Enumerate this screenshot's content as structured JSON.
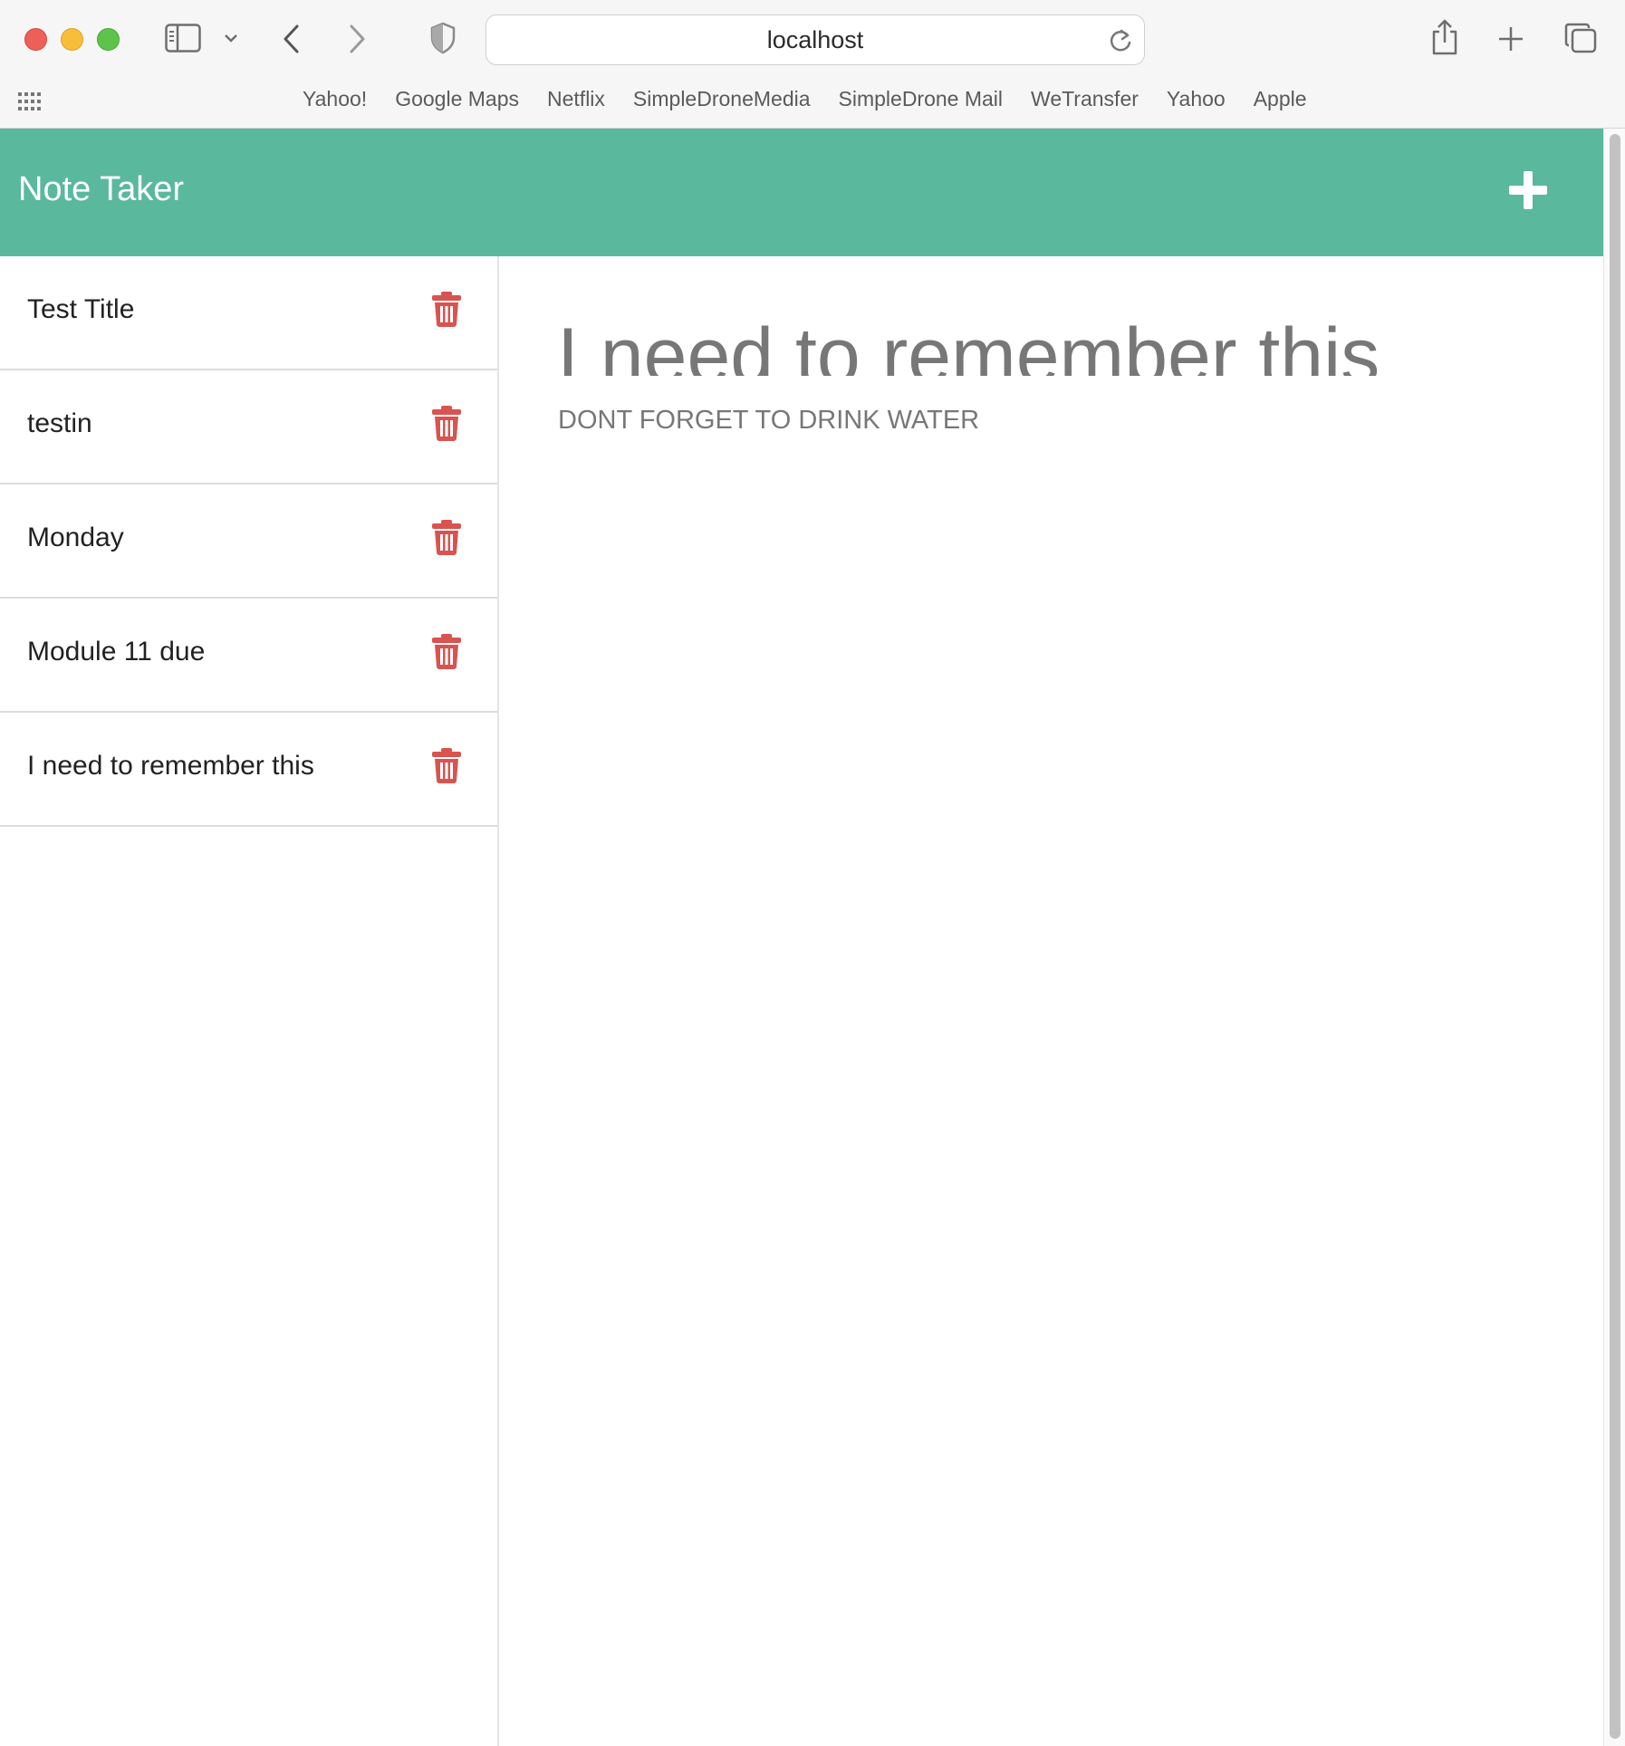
{
  "browser": {
    "url": "localhost",
    "icons": {
      "sidebar_toggle": "sidebar-icon",
      "back": "chevron-left-icon",
      "forward": "chevron-right-icon",
      "privacy": "shield-icon",
      "reload": "reload-icon",
      "share": "share-icon",
      "new_tab": "plus-icon",
      "tabs": "tabs-overview-icon"
    },
    "bookmarks": [
      "Yahoo!",
      "Google Maps",
      "Netflix",
      "SimpleDroneMedia",
      "SimpleDrone Mail",
      "WeTransfer",
      "Yahoo",
      "Apple"
    ]
  },
  "app": {
    "brand": "Note Taker",
    "accent_color": "#5ab99c",
    "delete_color": "#d9534f",
    "notes": [
      {
        "title": "Test Title"
      },
      {
        "title": "testin"
      },
      {
        "title": "Monday"
      },
      {
        "title": "Module 11 due"
      },
      {
        "title": "I need to remember this"
      }
    ],
    "active_note": {
      "title": "I need to remember this",
      "text": "DONT FORGET TO DRINK WATER"
    }
  }
}
